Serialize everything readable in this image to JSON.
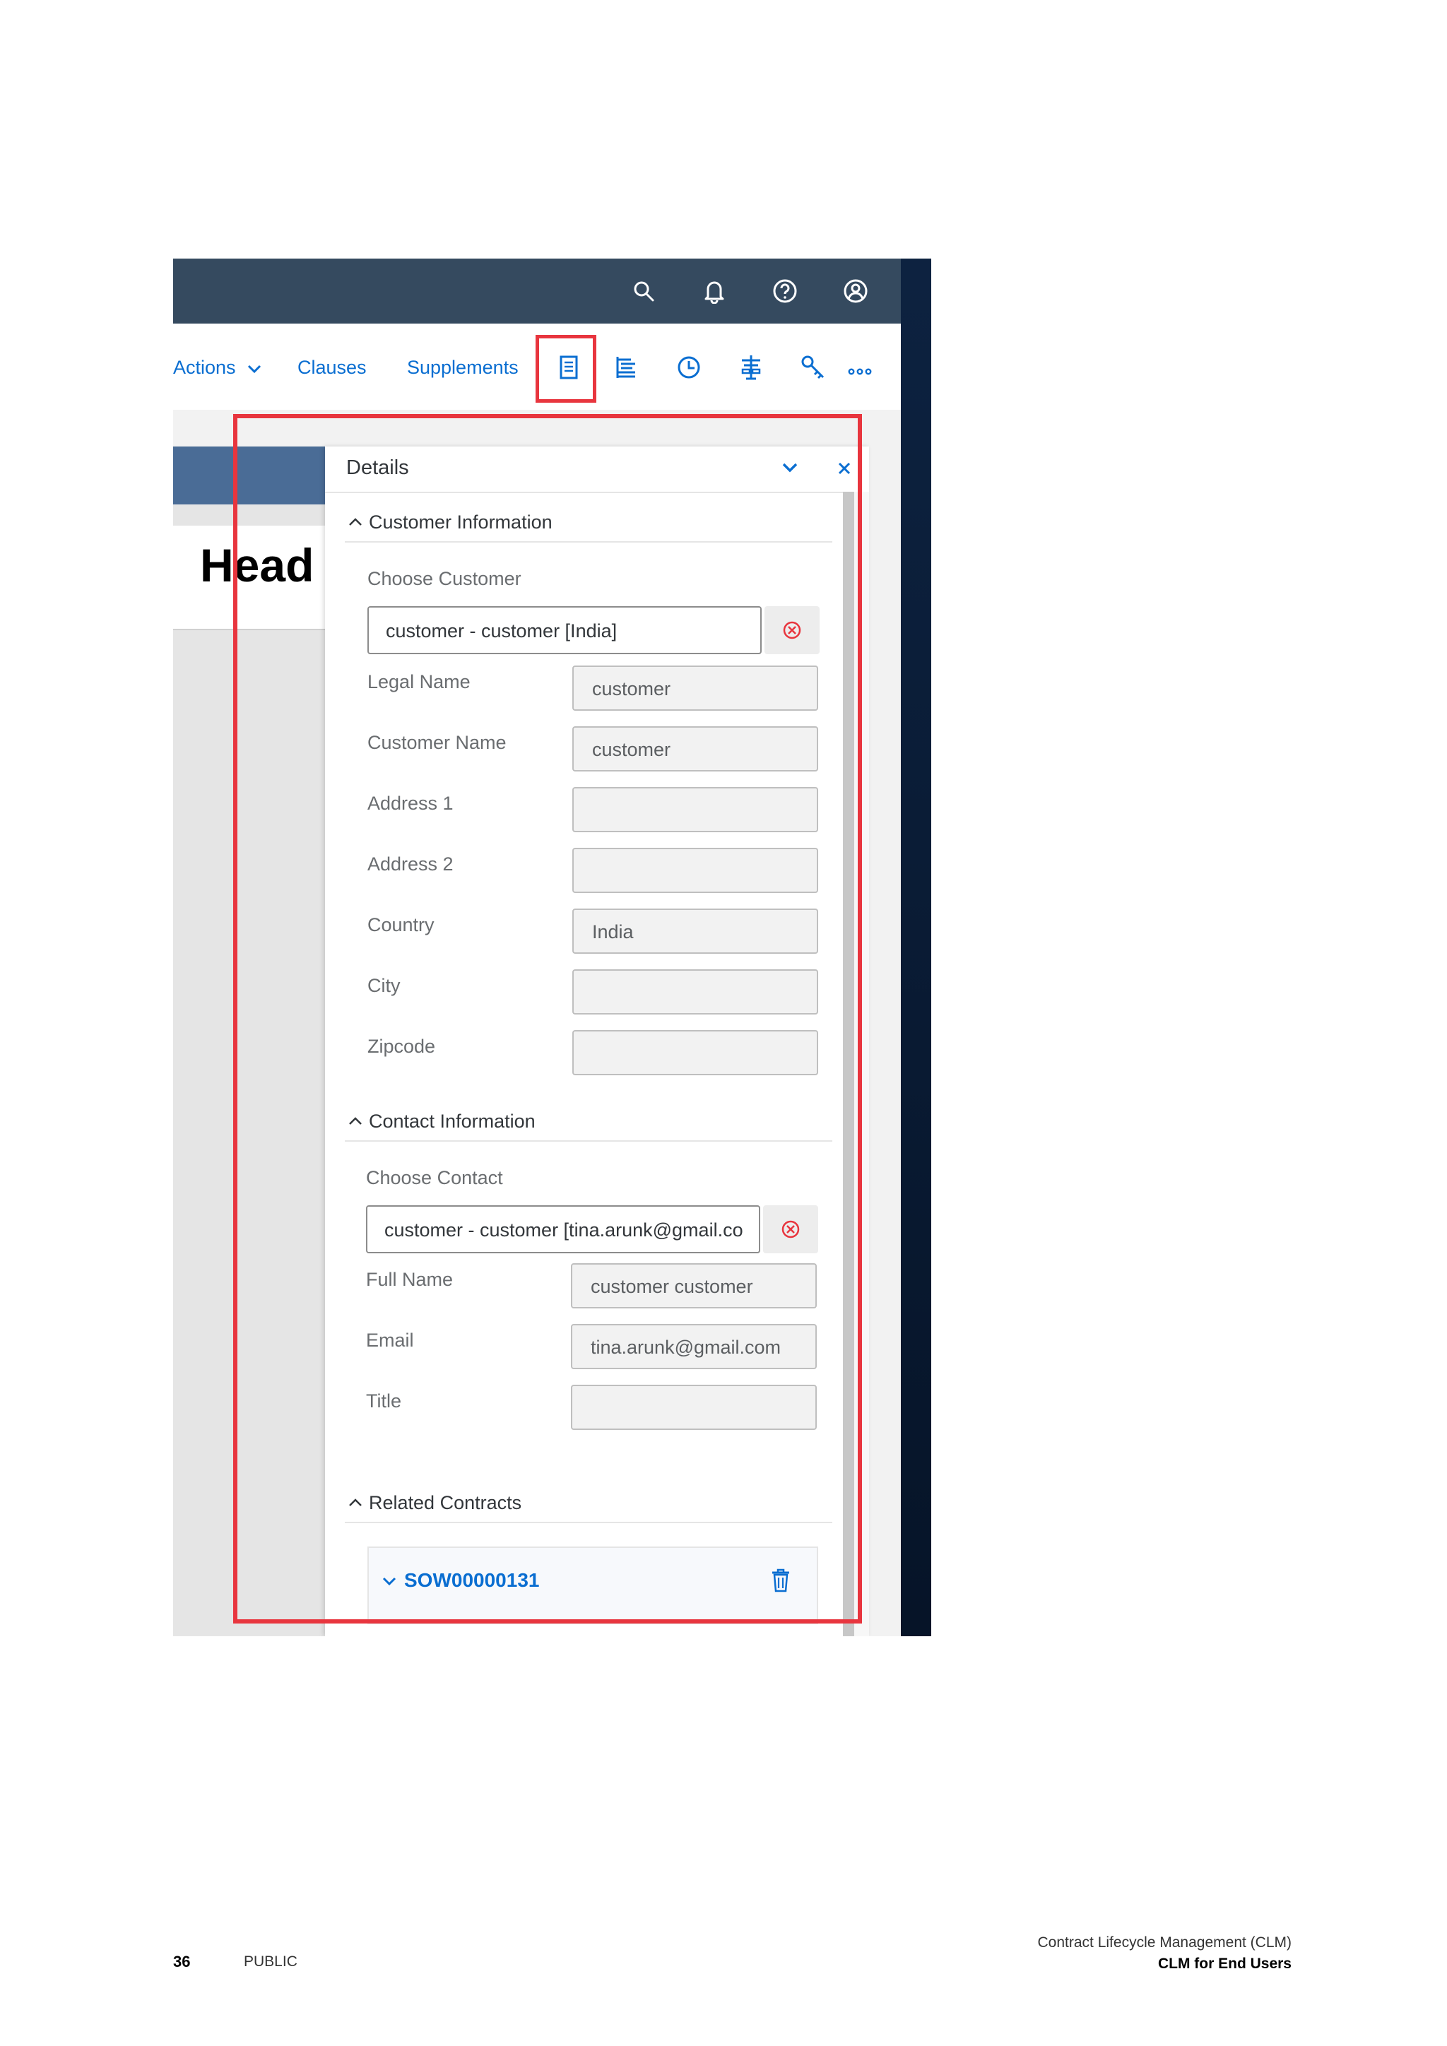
{
  "toolbar": {
    "actions_label": "Actions",
    "clauses_label": "Clauses",
    "supplements_label": "Supplements",
    "more_label": "..."
  },
  "background": {
    "heading_text": "Head"
  },
  "details_panel": {
    "title": "Details",
    "customer_section": {
      "title": "Customer Information",
      "choose_label": "Choose Customer",
      "choose_value": "customer - customer [India]",
      "fields": [
        {
          "label": "Legal Name",
          "value": "customer"
        },
        {
          "label": "Customer Name",
          "value": "customer"
        },
        {
          "label": "Address 1",
          "value": ""
        },
        {
          "label": "Address 2",
          "value": ""
        },
        {
          "label": "Country",
          "value": "India"
        },
        {
          "label": "City",
          "value": ""
        },
        {
          "label": "Zipcode",
          "value": ""
        }
      ]
    },
    "contact_section": {
      "title": "Contact Information",
      "choose_label": "Choose Contact",
      "choose_value": "customer - customer [tina.arunk@gmail.co",
      "fields": [
        {
          "label": "Full Name",
          "value": "customer customer"
        },
        {
          "label": "Email",
          "value": "tina.arunk@gmail.com"
        },
        {
          "label": "Title",
          "value": ""
        }
      ]
    },
    "related_section": {
      "title": "Related Contracts",
      "contract_id": "SOW00000131"
    }
  },
  "footer": {
    "page_number": "36",
    "classification": "PUBLIC",
    "doc_title": "Contract Lifecycle Management (CLM)",
    "doc_subtitle": "CLM for End Users"
  },
  "colors": {
    "shell": "#354a5f",
    "link": "#0a6ed1",
    "highlight": "#e8353e",
    "clear_icon": "#e8353e"
  }
}
